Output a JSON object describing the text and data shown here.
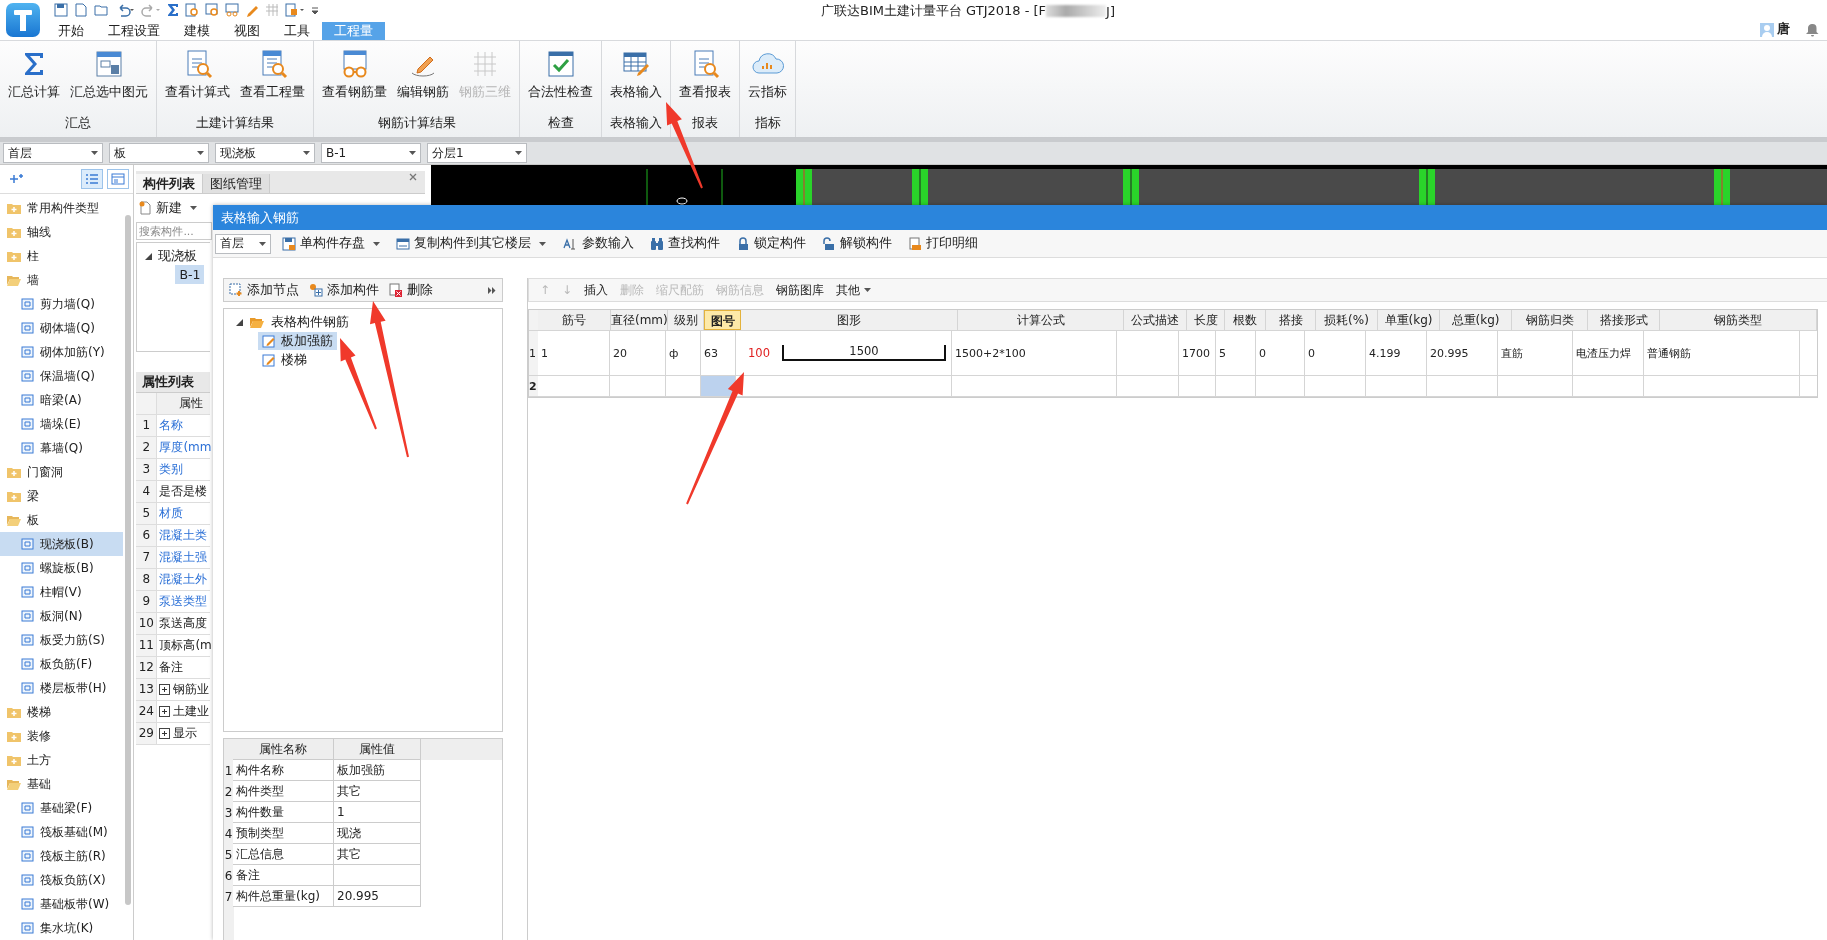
{
  "window": {
    "title": "广联达BIM土建计量平台 GTJ2018 - [F",
    "title_end": "J]"
  },
  "menu_tabs": [
    {
      "label": "开始",
      "selected": false
    },
    {
      "label": "工程设置",
      "selected": false
    },
    {
      "label": "建模",
      "selected": false
    },
    {
      "label": "视图",
      "selected": false
    },
    {
      "label": "工具",
      "selected": false
    },
    {
      "label": "工程量",
      "selected": true
    }
  ],
  "user": {
    "name": "唐"
  },
  "ribbon_groups": [
    {
      "label": "汇总",
      "buttons": [
        {
          "label": "汇总计算",
          "disabled": false
        },
        {
          "label": "汇总选中图元",
          "disabled": false
        }
      ]
    },
    {
      "label": "土建计算结果",
      "buttons": [
        {
          "label": "查看计算式",
          "disabled": false
        },
        {
          "label": "查看工程量",
          "disabled": false
        }
      ]
    },
    {
      "label": "钢筋计算结果",
      "buttons": [
        {
          "label": "查看钢筋量",
          "disabled": false
        },
        {
          "label": "编辑钢筋",
          "disabled": false
        },
        {
          "label": "钢筋三维",
          "disabled": true
        }
      ]
    },
    {
      "label": "检查",
      "buttons": [
        {
          "label": "合法性检查",
          "disabled": false
        }
      ]
    },
    {
      "label": "表格输入",
      "buttons": [
        {
          "label": "表格输入",
          "disabled": false
        }
      ]
    },
    {
      "label": "报表",
      "buttons": [
        {
          "label": "查看报表",
          "disabled": false
        }
      ]
    },
    {
      "label": "指标",
      "buttons": [
        {
          "label": "云指标",
          "disabled": false
        }
      ]
    }
  ],
  "selectors": [
    "首层",
    "板",
    "现浇板",
    "B-1",
    "分层1"
  ],
  "sidebar": {
    "items": [
      {
        "label": "常用构件类型",
        "expanded": false
      },
      {
        "label": "轴线",
        "expanded": false
      },
      {
        "label": "柱",
        "expanded": false
      },
      {
        "label": "墙",
        "expanded": true,
        "children": [
          {
            "label": "剪力墙(Q)",
            "selected": false
          },
          {
            "label": "砌体墙(Q)",
            "selected": false
          },
          {
            "label": "砌体加筋(Y)",
            "selected": false
          },
          {
            "label": "保温墙(Q)",
            "selected": false
          },
          {
            "label": "暗梁(A)",
            "selected": false
          },
          {
            "label": "墙垛(E)",
            "selected": false
          },
          {
            "label": "幕墙(Q)",
            "selected": false
          }
        ]
      },
      {
        "label": "门窗洞",
        "expanded": false
      },
      {
        "label": "梁",
        "expanded": false
      },
      {
        "label": "板",
        "expanded": true,
        "children": [
          {
            "label": "现浇板(B)",
            "selected": true
          },
          {
            "label": "螺旋板(B)",
            "selected": false
          },
          {
            "label": "柱帽(V)",
            "selected": false
          },
          {
            "label": "板洞(N)",
            "selected": false
          },
          {
            "label": "板受力筋(S)",
            "selected": false
          },
          {
            "label": "板负筋(F)",
            "selected": false
          },
          {
            "label": "楼层板带(H)",
            "selected": false
          }
        ]
      },
      {
        "label": "楼梯",
        "expanded": false
      },
      {
        "label": "装修",
        "expanded": false
      },
      {
        "label": "土方",
        "expanded": false
      },
      {
        "label": "基础",
        "expanded": true,
        "children": [
          {
            "label": "基础梁(F)",
            "selected": false
          },
          {
            "label": "筏板基础(M)",
            "selected": false
          },
          {
            "label": "筏板主筋(R)",
            "selected": false
          },
          {
            "label": "筏板负筋(X)",
            "selected": false
          },
          {
            "label": "基础板带(W)",
            "selected": false
          },
          {
            "label": "集水坑(K)",
            "selected": false
          }
        ]
      }
    ]
  },
  "component_panel": {
    "tabs": [
      {
        "label": "构件列表",
        "selected": true
      },
      {
        "label": "图纸管理",
        "selected": false
      }
    ],
    "new_button": "新建",
    "search_placeholder": "搜索构件...",
    "tree": [
      {
        "label": "现浇板",
        "expanded": true,
        "children": [
          {
            "label": "B-1",
            "selected": true
          }
        ]
      }
    ]
  },
  "property_panel": {
    "tab": "属性列表",
    "header": "属性",
    "rows": [
      {
        "number": "1",
        "label": "名称",
        "kind": "public"
      },
      {
        "number": "2",
        "label": "厚度(mm",
        "kind": "public"
      },
      {
        "number": "3",
        "label": "类别",
        "kind": "public"
      },
      {
        "number": "4",
        "label": "是否是楼",
        "kind": "private"
      },
      {
        "number": "5",
        "label": "材质",
        "kind": "public"
      },
      {
        "number": "6",
        "label": "混凝土类",
        "kind": "public"
      },
      {
        "number": "7",
        "label": "混凝土强",
        "kind": "public"
      },
      {
        "number": "8",
        "label": "混凝土外",
        "kind": "public"
      },
      {
        "number": "9",
        "label": "泵送类型",
        "kind": "public"
      },
      {
        "number": "10",
        "label": "泵送高度",
        "kind": "private"
      },
      {
        "number": "11",
        "label": "顶标高(m",
        "kind": "private"
      },
      {
        "number": "12",
        "label": "备注",
        "kind": "private"
      },
      {
        "number": "13",
        "label": "钢筋业",
        "kind": "group"
      },
      {
        "number": "24",
        "label": "土建业",
        "kind": "group"
      },
      {
        "number": "29",
        "label": "显示",
        "kind": "group"
      }
    ]
  },
  "dialog": {
    "title": "表格输入钢筋",
    "floor": "首层",
    "toolbar": [
      {
        "label": "单构件存盘",
        "dropdown": true
      },
      {
        "label": "复制构件到其它楼层",
        "dropdown": true
      },
      {
        "label": "参数输入",
        "dropdown": false
      },
      {
        "label": "查找构件",
        "dropdown": false
      },
      {
        "label": "锁定构件",
        "dropdown": false
      },
      {
        "label": "解锁构件",
        "dropdown": false
      },
      {
        "label": "打印明细",
        "dropdown": false
      }
    ],
    "tree_toolbar": [
      "添加节点",
      "添加构件",
      "删除"
    ],
    "tree": [
      {
        "label": "表格构件钢筋",
        "expanded": true,
        "children": [
          {
            "label": "板加强筋",
            "selected": true
          },
          {
            "label": "楼梯",
            "selected": false
          }
        ]
      }
    ],
    "properties": {
      "columns": [
        "属性名称",
        "属性值"
      ],
      "rows": [
        {
          "number": "1",
          "name": "构件名称",
          "value": "板加强筋"
        },
        {
          "number": "2",
          "name": "构件类型",
          "value": "其它"
        },
        {
          "number": "3",
          "name": "构件数量",
          "value": "1"
        },
        {
          "number": "4",
          "name": "预制类型",
          "value": "现浇"
        },
        {
          "number": "5",
          "name": "汇总信息",
          "value": "其它"
        },
        {
          "number": "6",
          "name": "备注"
        },
        {
          "number": "7",
          "name": "构件总重量(kg)",
          "value": "20.995"
        }
      ]
    },
    "table_toolbar": [
      {
        "label": "↑",
        "disabled": true,
        "dropdown": false
      },
      {
        "label": "↓",
        "disabled": true,
        "dropdown": false
      },
      {
        "label": "插入",
        "disabled": false,
        "dropdown": false
      },
      {
        "label": "删除",
        "disabled": true,
        "dropdown": false
      },
      {
        "label": "缩尺配筋",
        "disabled": true,
        "dropdown": false
      },
      {
        "label": "钢筋信息",
        "disabled": true,
        "dropdown": false
      },
      {
        "label": "钢筋图库",
        "disabled": false,
        "dropdown": false
      },
      {
        "label": "其他",
        "disabled": false,
        "dropdown": true
      }
    ],
    "table": {
      "columns": [
        {
          "label": "筋号",
          "selected": false
        },
        {
          "label": "直径(mm)",
          "selected": false
        },
        {
          "label": "级别",
          "selected": false
        },
        {
          "label": "图号",
          "selected": true
        },
        {
          "label": "图形",
          "selected": false
        },
        {
          "label": "计算公式",
          "selected": false
        },
        {
          "label": "公式描述",
          "selected": false
        },
        {
          "label": "长度",
          "selected": false
        },
        {
          "label": "根数",
          "selected": false
        },
        {
          "label": "搭接",
          "selected": false
        },
        {
          "label": "损耗(%)",
          "selected": false
        },
        {
          "label": "单重(kg)",
          "selected": false
        },
        {
          "label": "总重(kg)",
          "selected": false
        },
        {
          "label": "钢筋归类",
          "selected": false
        },
        {
          "label": "搭接形式",
          "selected": false
        },
        {
          "label": "钢筋类型",
          "selected": false
        }
      ],
      "rows": [
        {
          "number": "1",
          "selected": false,
          "bar_no": "1",
          "diameter": "20",
          "grade": "ф",
          "shape_no": "63",
          "shape": {
            "side": "100",
            "length": "1500"
          },
          "formula": "1500+2*100",
          "length": "1700",
          "count": "5",
          "lap": "0",
          "loss": "0",
          "unit_weight": "4.199",
          "total_weight": "20.995",
          "category": "直筋",
          "lap_type": "电渣压力焊",
          "bar_type": "普通钢筋"
        },
        {
          "number": "2",
          "selected": true
        }
      ]
    }
  }
}
